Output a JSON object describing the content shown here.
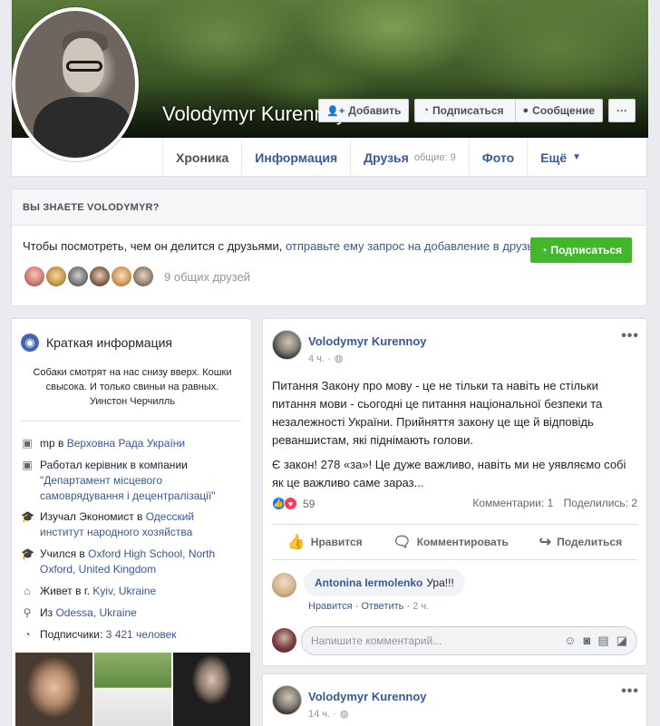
{
  "profile": {
    "name": "Volodymyr Kurennoy",
    "buttons": {
      "add": "Добавить",
      "follow": "Подписаться",
      "message": "Сообщение",
      "more": "···"
    },
    "tabs": [
      {
        "label": "Хроника"
      },
      {
        "label": "Информация"
      },
      {
        "label": "Друзья",
        "sub": "общие: 9"
      },
      {
        "label": "Фото"
      },
      {
        "label": "Ещё",
        "caret": "▼"
      }
    ]
  },
  "know": {
    "heading": "ВЫ ЗНАЕТЕ VOLODYMYR?",
    "text_prefix": "Чтобы посмотреть, чем он делится с друзьями, ",
    "text_link": "отправьте ему запрос на добавление в друзья.",
    "button": "Подписаться",
    "mutual": "9 общих друзей"
  },
  "intro": {
    "title": "Краткая информация",
    "quote": "Собаки смотрят на нас снизу вверх. Кошки свысока. И только свиньи на равных. Уинстон Черчилль",
    "rows": [
      {
        "icon": "briefcase-icon",
        "pre": "mp в ",
        "link": "Верховна Рада України",
        "post": ""
      },
      {
        "icon": "briefcase-icon",
        "pre": "Работал керівник в компании ",
        "link": "\"Департамент місцевого самоврядування і децентралізації\"",
        "post": ""
      },
      {
        "icon": "graduation-cap-icon",
        "pre": "Изучал Экономист в ",
        "link": "Одесский институт народного хозяйства",
        "post": ""
      },
      {
        "icon": "graduation-cap-icon",
        "pre": "Учился в ",
        "link": "Oxford High School, North Oxford, United Kingdom",
        "post": ""
      },
      {
        "icon": "home-icon",
        "pre": "Живет в г. ",
        "link": "Kyiv, Ukraine",
        "post": ""
      },
      {
        "icon": "location-pin-icon",
        "pre": "Из ",
        "link": "Odessa, Ukraine",
        "post": ""
      },
      {
        "icon": "rss-icon",
        "pre": "Подписчики: ",
        "link": "3 421 человек",
        "post": ""
      }
    ]
  },
  "post1": {
    "author": "Volodymyr Kurennoy",
    "time": "4 ч. ·",
    "more": "•••",
    "paragraphs": [
      "Питання Закону про мову - це не тільки та навіть не стільки питання мови - сьогодні це питання національної безпеки та незалежності України. Прийняття закону це ще й відповідь реваншистам, які піднімають голови.",
      "Є закон! 278 «за»! Це дуже важливо, навіть ми не уявляємо собі як це важливо саме зараз..."
    ],
    "reactions_count": "59",
    "comments": "Комментарии: 1",
    "shares": "Поделились: 2",
    "actions": {
      "like": "Нравится",
      "comment": "Комментировать",
      "share": "Поделиться"
    },
    "comment": {
      "author": "Antonina Iermolenko",
      "text": "Ура!!!",
      "like": "Нравится",
      "reply": "Ответить",
      "time": "2 ч."
    },
    "input_placeholder": "Напишите комментарий..."
  },
  "post2": {
    "author": "Volodymyr Kurennoy",
    "time": "14 ч. ·",
    "more": "•••"
  }
}
